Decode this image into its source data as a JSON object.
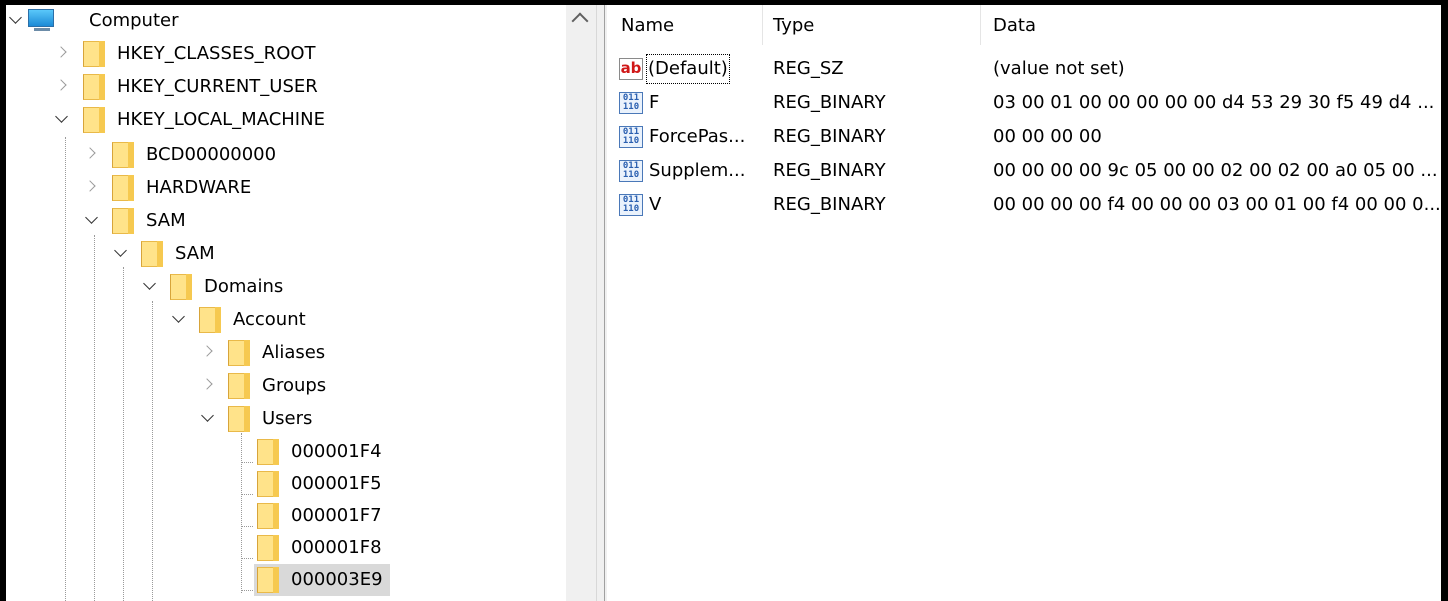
{
  "tree": {
    "root": "Computer",
    "items": [
      {
        "label": "HKEY_CLASSES_ROOT"
      },
      {
        "label": "HKEY_CURRENT_USER"
      },
      {
        "label": "HKEY_LOCAL_MACHINE"
      },
      {
        "label": "BCD00000000"
      },
      {
        "label": "HARDWARE"
      },
      {
        "label": "SAM"
      },
      {
        "label": "SAM"
      },
      {
        "label": "Domains"
      },
      {
        "label": "Account"
      },
      {
        "label": "Aliases"
      },
      {
        "label": "Groups"
      },
      {
        "label": "Users"
      },
      {
        "label": "000001F4"
      },
      {
        "label": "000001F5"
      },
      {
        "label": "000001F7"
      },
      {
        "label": "000001F8"
      },
      {
        "label": "000003E9"
      }
    ],
    "selected": "000003E9"
  },
  "list": {
    "columns": [
      "Name",
      "Type",
      "Data"
    ],
    "rows": [
      {
        "icon": "string-value-icon",
        "name": "(Default)",
        "type": "REG_SZ",
        "data": "(value not set)"
      },
      {
        "icon": "binary-value-icon",
        "name": "F",
        "type": "REG_BINARY",
        "data": "03 00 01 00 00 00 00 00 d4 53 29 30 f5 49 d4 ..."
      },
      {
        "icon": "binary-value-icon",
        "name": "ForcePas...",
        "type": "REG_BINARY",
        "data": "00 00 00 00"
      },
      {
        "icon": "binary-value-icon",
        "name": "Supplem...",
        "type": "REG_BINARY",
        "data": "00 00 00 00 9c 05 00 00 02 00 02 00 a0 05 00 ..."
      },
      {
        "icon": "binary-value-icon",
        "name": "V",
        "type": "REG_BINARY",
        "data": "00 00 00 00 f4 00 00 00 03 00 01 00 f4 00 00 0..."
      }
    ]
  },
  "colors": {
    "folder": "#ffe38a",
    "selection": "#d9d9d9",
    "string_icon_text": "#d01818",
    "binary_icon_text": "#2a5fb0"
  }
}
